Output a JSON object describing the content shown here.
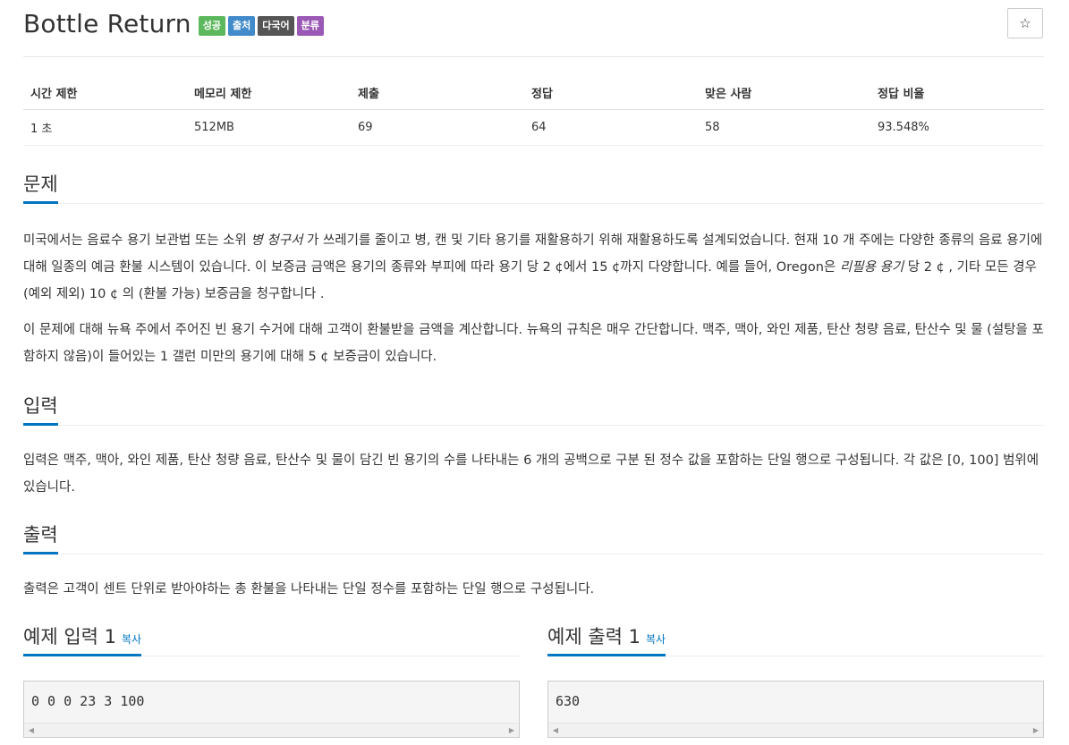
{
  "header": {
    "title": "Bottle Return",
    "labels": [
      {
        "text": "성공",
        "color": "#5cb85c"
      },
      {
        "text": "출처",
        "color": "#428bca"
      },
      {
        "text": "다국어",
        "color": "#555555"
      },
      {
        "text": "분류",
        "color": "#9b59b6"
      }
    ],
    "star": "☆"
  },
  "info_table": {
    "headers": [
      "시간 제한",
      "메모리 제한",
      "제출",
      "정답",
      "맞은 사람",
      "정답 비율"
    ],
    "values": [
      "1 초",
      "512MB",
      "69",
      "64",
      "58",
      "93.548%"
    ]
  },
  "problem": {
    "title": "문제",
    "p1_a": "미국에서는 음료수 용기 보관법 또는 소위 ",
    "p1_em1": "병 청구서",
    "p1_b": " 가 쓰레기를 줄이고 병, 캔 및 기타 용기를 재활용하기 위해 재활용하도록 설계되었습니다. 현재 10 개 주에는 다양한 종류의 음료 용기에 대해 일종의 예금 환불 시스템이 있습니다. 이 보증금 금액은 용기의 종류와 부피에 따라 용기 당 2 ¢에서 15 ¢까지 다양합니다. 예를 들어, Oregon은 ",
    "p1_em2": "리필용 용기",
    "p1_c": " 당 2 ¢ , 기타 모든 경우 (예외 제외) 10 ¢ 의 (환불 가능) 보증금을 청구합니다 .",
    "p2": "이 문제에 대해 뉴욕 주에서 주어진 빈 용기 수거에 대해 고객이 환불받을 금액을 계산합니다. 뉴욕의 규칙은 매우 간단합니다. 맥주, 맥아, 와인 제품, 탄산 청량 음료, 탄산수 및 물 (설탕을 포함하지 않음)이 들어있는 1 갤런 미만의 용기에 대해 5 ¢ 보증금이 있습니다."
  },
  "input": {
    "title": "입력",
    "text": "입력은 맥주, 맥아, 와인 제품, 탄산 청량 음료, 탄산수 및 물이 담긴 빈 용기의 수를 나타내는 6 개의 공백으로 구분 된 정수 값을 포함하는 단일 행으로 구성됩니다. 각 값은 [0, 100] 범위에 있습니다."
  },
  "output": {
    "title": "출력",
    "text": "출력은 고객이 센트 단위로 받아야하는 총 환불을 나타내는 단일 정수를 포함하는 단일 행으로 구성됩니다."
  },
  "samples": {
    "input_title": "예제 입력 1",
    "output_title": "예제 출력 1",
    "copy_label": "복사",
    "input_value": "0 0 0 23 3 100",
    "output_value": "630",
    "scroll_left": "◀",
    "scroll_right": "▶"
  }
}
